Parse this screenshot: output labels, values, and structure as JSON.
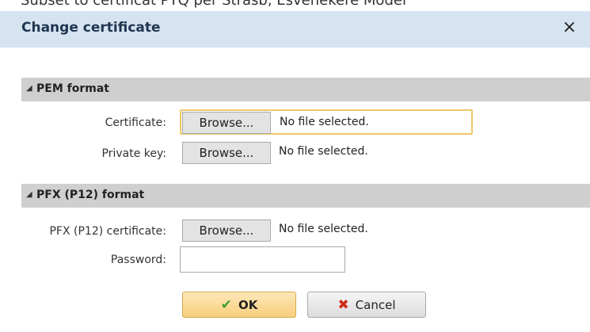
{
  "background_strip": {
    "text": "Subset to certificat PTQ per Strasb, Esvenekere Model"
  },
  "dialog": {
    "title": "Change certificate",
    "close_symbol": "×"
  },
  "pem_section": {
    "title": "PEM format",
    "certificate": {
      "label": "Certificate:",
      "browse_label": "Browse...",
      "status": "No file selected."
    },
    "private_key": {
      "label": "Private key:",
      "browse_label": "Browse...",
      "status": "No file selected."
    }
  },
  "pfx_section": {
    "title": "PFX (P12) format",
    "certificate": {
      "label": "PFX (P12) certificate:",
      "browse_label": "Browse...",
      "status": "No file selected."
    },
    "password": {
      "label": "Password:",
      "value": ""
    }
  },
  "buttons": {
    "ok_label": "OK",
    "cancel_label": "Cancel",
    "ok_icon": "check-icon",
    "cancel_icon": "x-icon"
  },
  "colors": {
    "titlebar": "#d6e3f0",
    "section_header": "#cfcfcf",
    "focus_border": "#f0c86a",
    "ok_button": "#f8cf7c",
    "check": "#3c9e2e",
    "cancel_x": "#cf2a1a"
  }
}
